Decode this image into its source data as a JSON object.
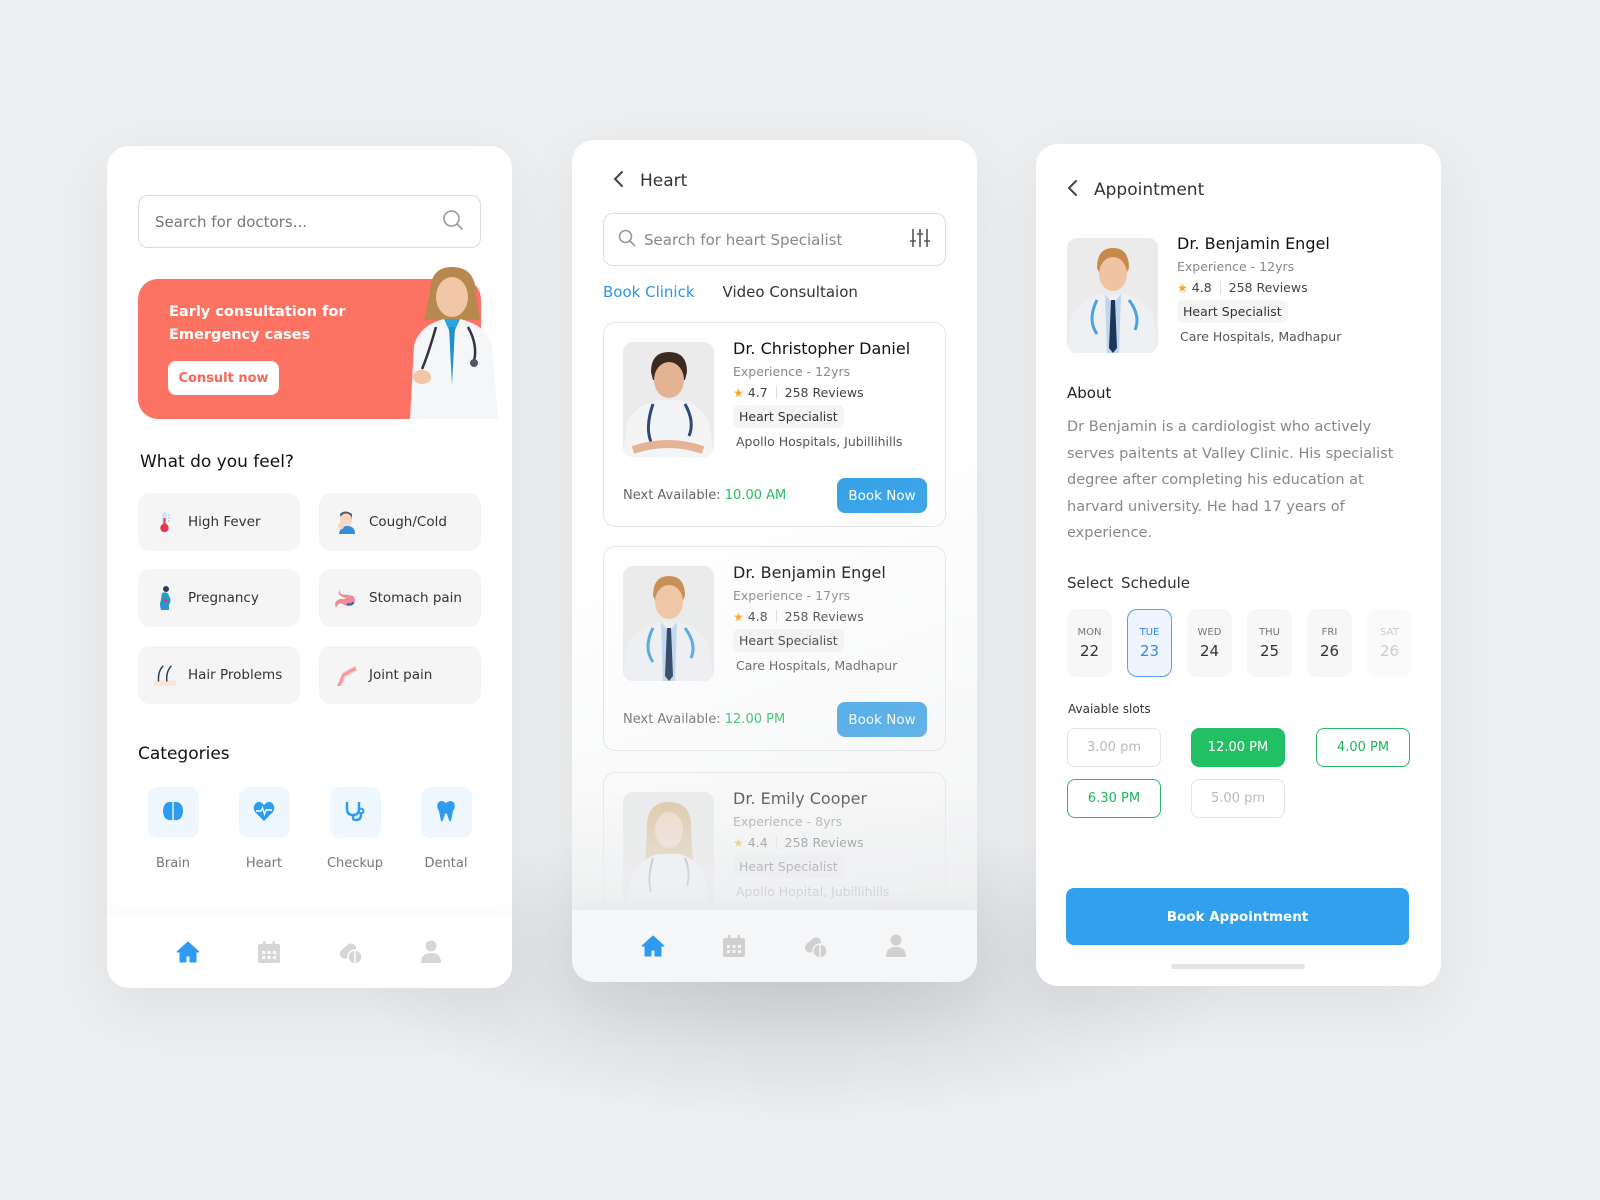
{
  "colors": {
    "background": "#eceef0",
    "primary": "#309fe8",
    "banner": "#fc7263",
    "success": "#22bf64",
    "star": "#f7a823"
  },
  "home": {
    "search": {
      "placeholder": "Search for doctors...",
      "icon": "search-icon"
    },
    "banner": {
      "title": "Early consultation for Emergency cases",
      "button_label": "Consult now"
    },
    "symptoms_title": "What do you feel?",
    "symptoms": [
      {
        "label": "High Fever",
        "icon": "thermometer-icon"
      },
      {
        "label": "Cough/Cold",
        "icon": "cough-icon"
      },
      {
        "label": "Pregnancy",
        "icon": "pregnancy-icon"
      },
      {
        "label": "Stomach  pain",
        "icon": "stomach-icon"
      },
      {
        "label": "Hair Problems",
        "icon": "hair-icon"
      },
      {
        "label": "Joint  pain",
        "icon": "joint-icon"
      }
    ],
    "categories_title": "Categories",
    "categories": [
      {
        "label": "Brain",
        "icon": "brain-icon"
      },
      {
        "label": "Heart",
        "icon": "heart-pulse-icon"
      },
      {
        "label": "Checkup",
        "icon": "stethoscope-icon"
      },
      {
        "label": "Dental",
        "icon": "tooth-icon"
      }
    ]
  },
  "bottom_nav": [
    {
      "name": "home",
      "icon": "home-icon",
      "active": true
    },
    {
      "name": "calendar",
      "icon": "calendar-icon",
      "active": false
    },
    {
      "name": "pills",
      "icon": "pills-icon",
      "active": false
    },
    {
      "name": "profile",
      "icon": "user-icon",
      "active": false
    }
  ],
  "heart": {
    "title": "Heart",
    "search": {
      "placeholder": "Search for heart Specialist"
    },
    "tabs": [
      {
        "label": "Book Clinick",
        "active": true
      },
      {
        "label": "Video Consultaion",
        "active": false
      }
    ],
    "next_available_label": "Next Available:",
    "book_label": "Book Now",
    "doctors": [
      {
        "name": "Dr. Christopher Daniel",
        "experience": "Experience - 12yrs",
        "rating": "4.7",
        "reviews": "258 Reviews",
        "specialty": "Heart Specialist",
        "hospital": "Apollo Hospitals, Jubillihills",
        "next_available": "10.00 AM"
      },
      {
        "name": "Dr. Benjamin Engel",
        "experience": "Experience - 17yrs",
        "rating": "4.8",
        "reviews": "258 Reviews",
        "specialty": "Heart Specialist",
        "hospital": "Care Hospitals, Madhapur",
        "next_available": "12.00 PM"
      },
      {
        "name": "Dr. Emily Cooper",
        "experience": "Experience - 8yrs",
        "rating": "4.4",
        "reviews": "258 Reviews",
        "specialty": "Heart Specialist",
        "hospital": "Apollo Hopital, Jubillihills"
      }
    ]
  },
  "appointment": {
    "title": "Appointment",
    "doctor": {
      "name": "Dr. Benjamin Engel",
      "experience": "Experience - 12yrs",
      "rating": "4.8",
      "reviews": "258 Reviews",
      "specialty": "Heart Specialist",
      "hospital": "Care Hospitals, Madhapur"
    },
    "about_title": "About",
    "about_text": "Dr Benjamin is a cardiologist who actively serves paitents at Valley Clinic. His specialist degree after completing his education at harvard university. He had 17 years of experience.",
    "schedule_title": "Select  Schedule",
    "days": [
      {
        "day": "MON",
        "date": "22",
        "state": "normal"
      },
      {
        "day": "TUE",
        "date": "23",
        "state": "selected"
      },
      {
        "day": "WED",
        "date": "24",
        "state": "normal"
      },
      {
        "day": "THU",
        "date": "25",
        "state": "normal"
      },
      {
        "day": "FRI",
        "date": "26",
        "state": "normal"
      },
      {
        "day": "SAT",
        "date": "26",
        "state": "disabled"
      }
    ],
    "slots_title": "Avaiable slots",
    "slots": [
      {
        "label": "3.00 pm",
        "state": "disabled"
      },
      {
        "label": "12.00 PM",
        "state": "selected"
      },
      {
        "label": "4.00 PM",
        "state": "available"
      },
      {
        "label": "6.30 PM",
        "state": "available"
      },
      {
        "label": "5.00 pm",
        "state": "disabled"
      }
    ],
    "book_button": "Book Appointment"
  }
}
